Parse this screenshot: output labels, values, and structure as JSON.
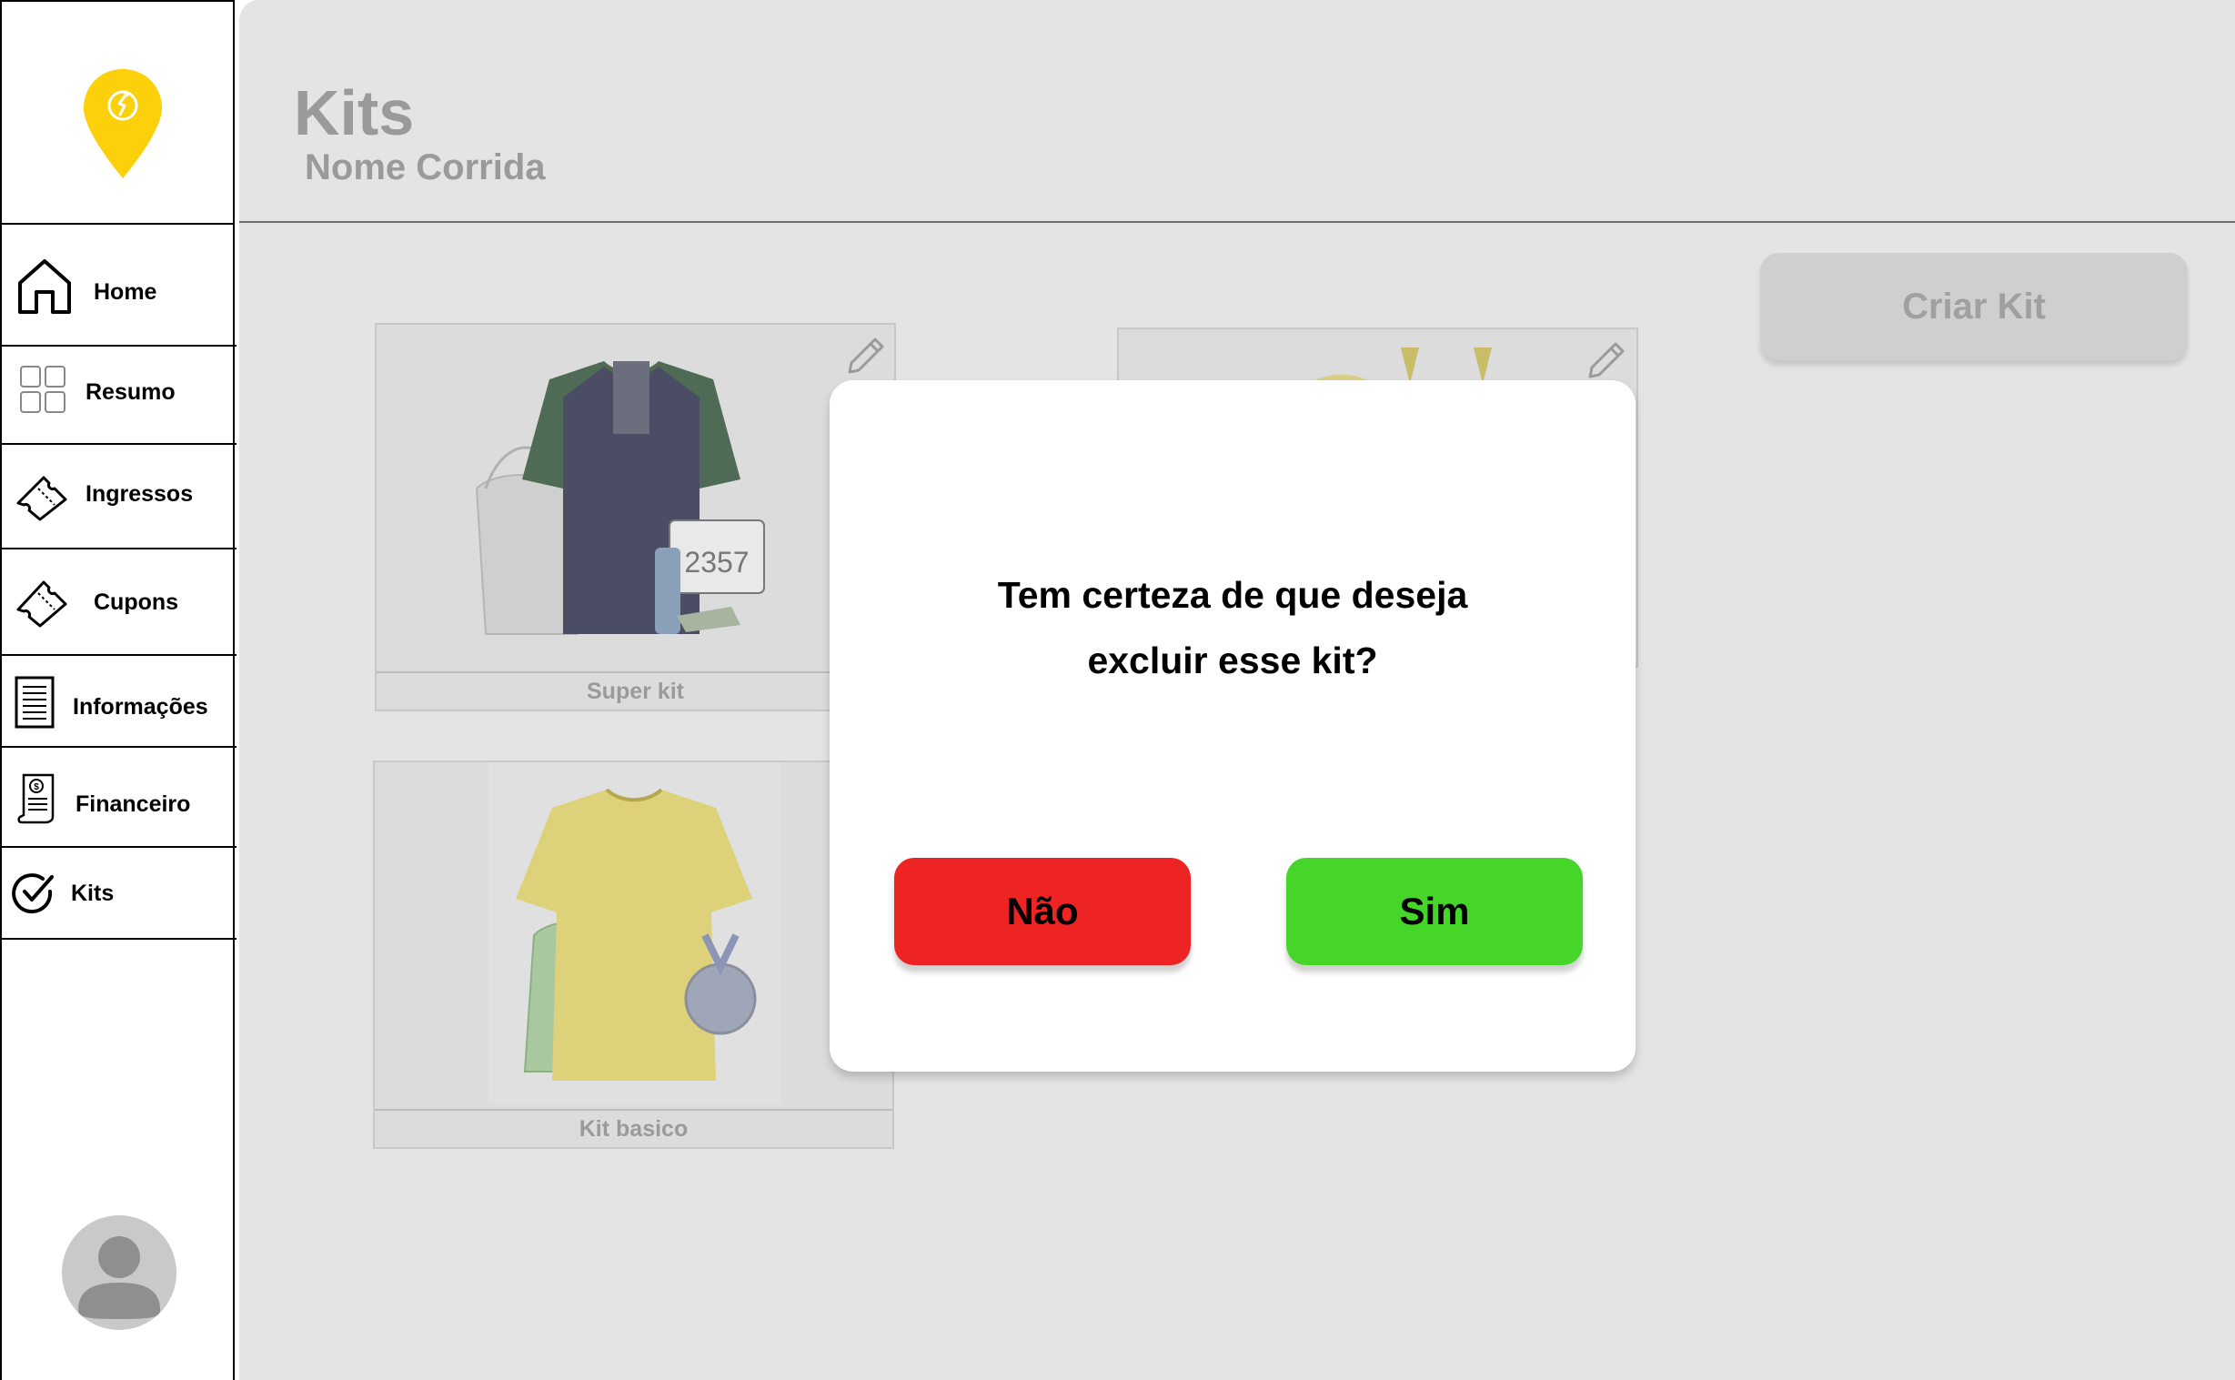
{
  "sidebar": {
    "logo_color": "#fcd00b",
    "items": [
      {
        "label": "Home",
        "icon": "home-icon"
      },
      {
        "label": "Resumo",
        "icon": "grid-icon"
      },
      {
        "label": "Ingressos",
        "icon": "ticket-icon"
      },
      {
        "label": "Cupons",
        "icon": "coupon-icon"
      },
      {
        "label": "Informações",
        "icon": "document-icon"
      },
      {
        "label": "Financeiro",
        "icon": "receipt-icon"
      },
      {
        "label": "Kits",
        "icon": "check-circle-icon"
      }
    ],
    "avatar": "user-avatar-icon"
  },
  "header": {
    "title": "Kits",
    "subtitle": "Nome Corrida"
  },
  "toolbar": {
    "create_label": "Criar Kit"
  },
  "kits": [
    {
      "name": "Super kit",
      "image": "tshirt-kit-image"
    },
    {
      "name": "Kit basico",
      "image": "yellow-tshirt-kit-image"
    }
  ],
  "dialog": {
    "line1": "Tem certeza de que deseja",
    "line2": "excluir esse kit?",
    "no_label": "Não",
    "yes_label": "Sim",
    "no_color": "#ee2424",
    "yes_color": "#46d62a"
  }
}
